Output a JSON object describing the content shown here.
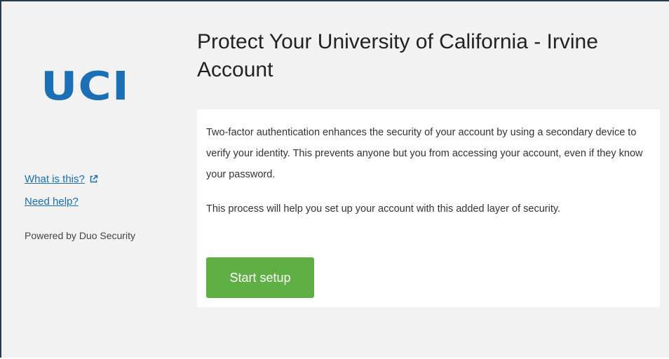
{
  "sidebar": {
    "logo_text": "UCI",
    "what_is_this": "What is this?",
    "need_help": "Need help?",
    "powered_by": "Powered by Duo Security"
  },
  "main": {
    "title": "Protect Your University of California - Irvine Account",
    "paragraph_1": "Two-factor authentication enhances the security of your account by using a secondary device to verify your identity. This prevents anyone but you from accessing your account, even if they know your password.",
    "paragraph_2": "This process will help you set up your account with this added layer of security.",
    "start_button": "Start setup"
  },
  "colors": {
    "logo": "#1b6fb4",
    "link": "#1a6fb0",
    "button": "#5fb044",
    "background": "#f2f2f2"
  },
  "icons": {
    "external_link": "external-link-icon"
  }
}
